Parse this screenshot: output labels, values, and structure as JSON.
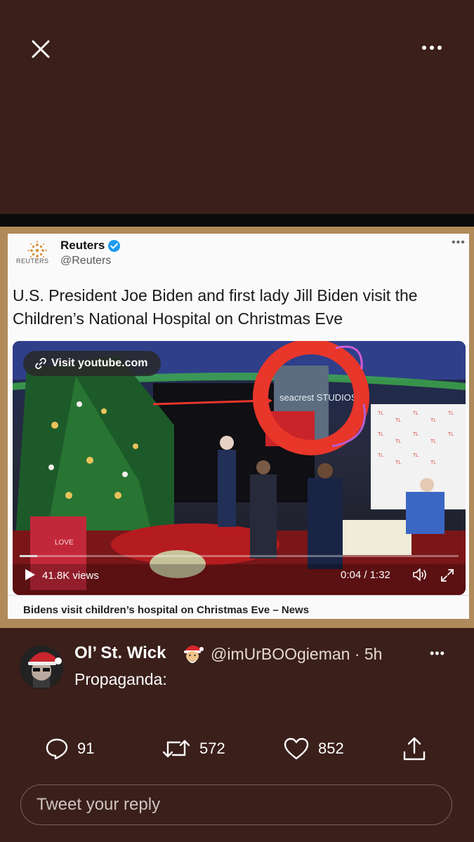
{
  "quoted_tweet": {
    "logo_word": "REUTERS",
    "name": "Reuters",
    "handle": "@Reuters",
    "headline": "U.S. President Joe Biden and first lady Jill Biden visit the Children’s National Hospital on Christmas Eve",
    "video": {
      "link_label": "Visit youtube.com",
      "views": "41.8K views",
      "time": "0:04 / 1:32",
      "progress": 0.04,
      "signage": "seacrest STUDIOS",
      "sign_love": "LOVE"
    },
    "link_title": "Bidens visit children’s hospital on Christmas Eve – News"
  },
  "tweet": {
    "name": "Ol’ St. Wick",
    "handle_time": "@imUrBOOgieman · 5h",
    "text": "Propaganda:"
  },
  "actions": {
    "replies": "91",
    "retweets": "572",
    "likes": "852"
  },
  "reply": {
    "placeholder": "Tweet your reply"
  },
  "colors": {
    "background": "#3a1f1a",
    "frame": "#b08a5a",
    "verified": "#1d9bf0",
    "annotation_red": "#e8362a"
  }
}
